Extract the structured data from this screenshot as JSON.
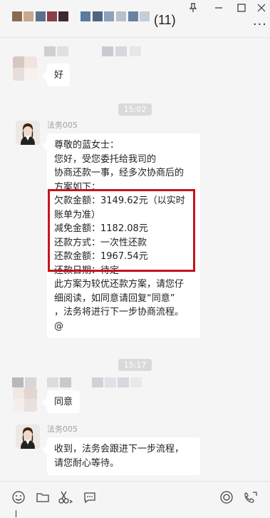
{
  "titlebar": {
    "count": "(11)",
    "pin_icon": "pin-icon",
    "minimize_icon": "minimize-icon",
    "maximize_icon": "maximize-icon",
    "close_icon": "close-icon",
    "more_icon": "more-icon"
  },
  "messages": {
    "time1": "15:02",
    "time2": "15:17",
    "sender": "法务005",
    "user_msg1": "好",
    "law_msg1_lines": [
      "尊敬的蓝女士：",
      "您好，受您委托给我司的",
      "协商还款一事，经多次协商后的",
      "方案如下：",
      "欠款金额：3149.62元（以实时",
      "账单为准）",
      "减免金额：1182.08元",
      "还款方式：一次性还款",
      "还款金额：1967.54元",
      "还款日期：待定",
      "此方案为较优还款方案，请您仔",
      "细阅读，如同意请回复“同意”",
      "，法务将进行下一步协商流程。",
      "@"
    ],
    "user_msg2": "同意",
    "law_msg2_lines": [
      "收到，法务会跟进下一步流程，",
      "请您耐心等待。"
    ]
  },
  "toolbar": {
    "icons": [
      "emoji-icon",
      "folder-icon",
      "scissors-icon",
      "chat-icon",
      "live-icon",
      "video-call-icon"
    ]
  }
}
